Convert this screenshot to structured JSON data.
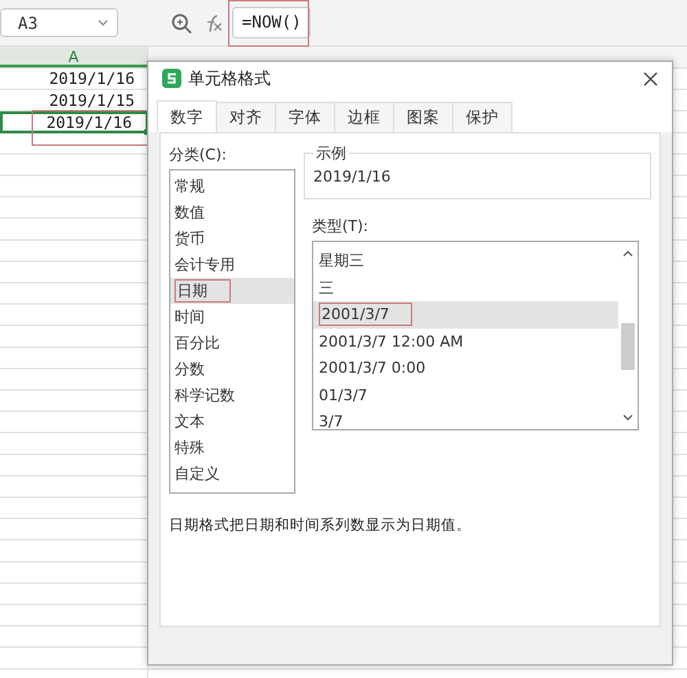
{
  "name_box": {
    "value": "A3"
  },
  "formula_bar": {
    "value": "=NOW()"
  },
  "sheet": {
    "columns": [
      {
        "label": "A",
        "selected": true
      }
    ],
    "rows": [
      {
        "value": "2019/1/16",
        "selected": false
      },
      {
        "value": "2019/1/15",
        "selected": false
      },
      {
        "value": "2019/1/16",
        "selected": true
      }
    ]
  },
  "dialog": {
    "title": "单元格格式",
    "tabs": [
      {
        "label": "数字",
        "selected": true
      },
      {
        "label": "对齐",
        "selected": false
      },
      {
        "label": "字体",
        "selected": false
      },
      {
        "label": "边框",
        "selected": false
      },
      {
        "label": "图案",
        "selected": false
      },
      {
        "label": "保护",
        "selected": false
      }
    ],
    "category": {
      "label": "分类(C):",
      "items": [
        {
          "label": "常规",
          "selected": false
        },
        {
          "label": "数值",
          "selected": false
        },
        {
          "label": "货币",
          "selected": false
        },
        {
          "label": "会计专用",
          "selected": false
        },
        {
          "label": "日期",
          "selected": true
        },
        {
          "label": "时间",
          "selected": false
        },
        {
          "label": "百分比",
          "selected": false
        },
        {
          "label": "分数",
          "selected": false
        },
        {
          "label": "科学记数",
          "selected": false
        },
        {
          "label": "文本",
          "selected": false
        },
        {
          "label": "特殊",
          "selected": false
        },
        {
          "label": "自定义",
          "selected": false
        }
      ]
    },
    "sample": {
      "label": "示例",
      "value": "2019/1/16"
    },
    "type": {
      "label": "类型(T):",
      "items": [
        {
          "label": "星期三",
          "selected": false
        },
        {
          "label": "三",
          "selected": false
        },
        {
          "label": "2001/3/7",
          "selected": true
        },
        {
          "label": "2001/3/7 12:00 AM",
          "selected": false
        },
        {
          "label": "2001/3/7 0:00",
          "selected": false
        },
        {
          "label": "01/3/7",
          "selected": false
        },
        {
          "label": "3/7",
          "selected": false
        }
      ]
    },
    "description": "日期格式把日期和时间系列数显示为日期值。"
  }
}
